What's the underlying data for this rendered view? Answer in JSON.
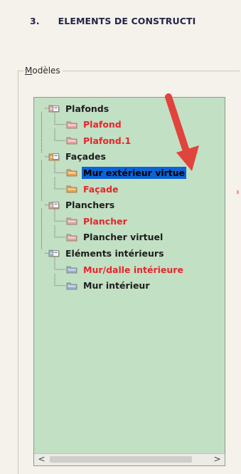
{
  "section": {
    "number": "3.",
    "title": "ELEMENTS DE CONSTRUCTI"
  },
  "groupbox": {
    "label_mnemonic": "M",
    "label_rest": "odèles"
  },
  "tree": {
    "nodes": [
      {
        "label": "Plafonds",
        "level": 0,
        "expanded": true,
        "color": "black",
        "icon": "ceiling-folder-icon"
      },
      {
        "label": "Plafond",
        "level": 1,
        "color": "red",
        "icon": "ceiling-item-icon"
      },
      {
        "label": "Plafond.1",
        "level": 1,
        "color": "red",
        "icon": "ceiling-item-icon"
      },
      {
        "label": "Façades",
        "level": 0,
        "expanded": true,
        "color": "black",
        "icon": "facade-folder-icon"
      },
      {
        "label": "Mur extérieur virtue",
        "level": 1,
        "color": "black",
        "selected": true,
        "icon": "facade-item-icon"
      },
      {
        "label": "Façade",
        "level": 1,
        "color": "red",
        "icon": "facade-item-icon"
      },
      {
        "label": "Planchers",
        "level": 0,
        "expanded": true,
        "color": "black",
        "icon": "floor-folder-icon"
      },
      {
        "label": "Plancher",
        "level": 1,
        "color": "red",
        "icon": "floor-item-icon"
      },
      {
        "label": "Plancher virtuel",
        "level": 1,
        "color": "black",
        "icon": "floor-item-icon"
      },
      {
        "label": "Eléments intérieurs",
        "level": 0,
        "expanded": true,
        "color": "black",
        "icon": "interior-folder-icon"
      },
      {
        "label": "Mur/dalle intérieure",
        "level": 1,
        "color": "red",
        "icon": "interior-item-icon"
      },
      {
        "label": "Mur intérieur",
        "level": 1,
        "color": "black",
        "icon": "interior-item-icon"
      }
    ]
  },
  "scrollbar": {
    "left_glyph": "<",
    "right_glyph": ">"
  },
  "colors": {
    "tree_background": "#c2e0c4",
    "selection": "#0a64d8",
    "red_label": "#e6262c",
    "annotation_arrow": "#e0443c"
  }
}
